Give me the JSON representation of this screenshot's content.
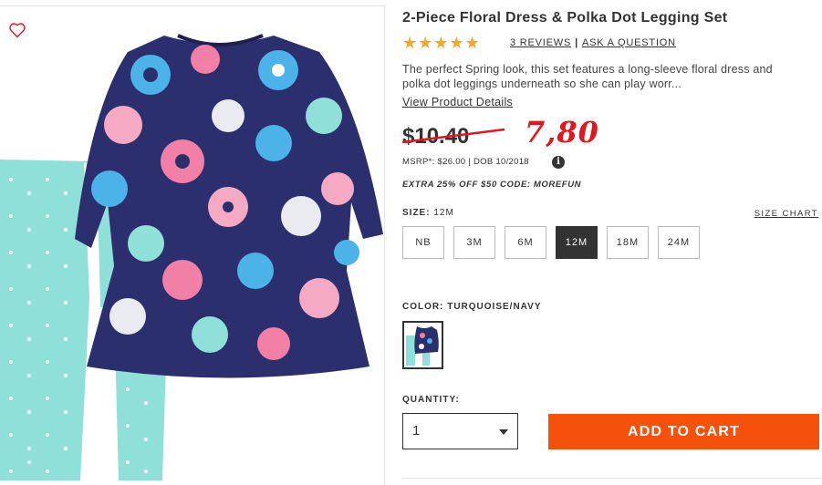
{
  "product": {
    "title": "2-Piece Floral Dress & Polka Dot Legging Set",
    "rating_stars": "★★★★★",
    "reviews_link": "3 REVIEWS",
    "ask_link": "ASK A QUESTION",
    "link_separator": "|",
    "description": "The perfect Spring look, this set features a long-sleeve floral dress and polka dot leggings underneath so she can play worr...",
    "view_details": "View Product Details"
  },
  "pricing": {
    "old_price": "$10.40",
    "new_price": "7,80",
    "msrp": "MSRP*: $26.00 | DOB 10/2018",
    "info_glyph": "i",
    "promo": "EXTRA 25% OFF $50 CODE: MOREFUN"
  },
  "size": {
    "label_prefix": "SIZE:",
    "selected": "12M",
    "chart_link": "SIZE CHART",
    "options": [
      "NB",
      "3M",
      "6M",
      "12M",
      "18M",
      "24M"
    ]
  },
  "color": {
    "label": "COLOR: TURQUOISE/NAVY"
  },
  "quantity": {
    "label": "QUANTITY:",
    "value": "1"
  },
  "cart": {
    "button_label": "ADD TO CART"
  },
  "colors": {
    "accent": "#f5500c",
    "stars": "#f5a623",
    "handwritten_price": "#e4151f",
    "dress_navy": "#2b2f6e",
    "legging_turquoise": "#8fe0d8"
  },
  "icons": {
    "favorite": "heart-outline-icon",
    "info": "info-circle-icon",
    "dropdown": "chevron-down-icon"
  }
}
